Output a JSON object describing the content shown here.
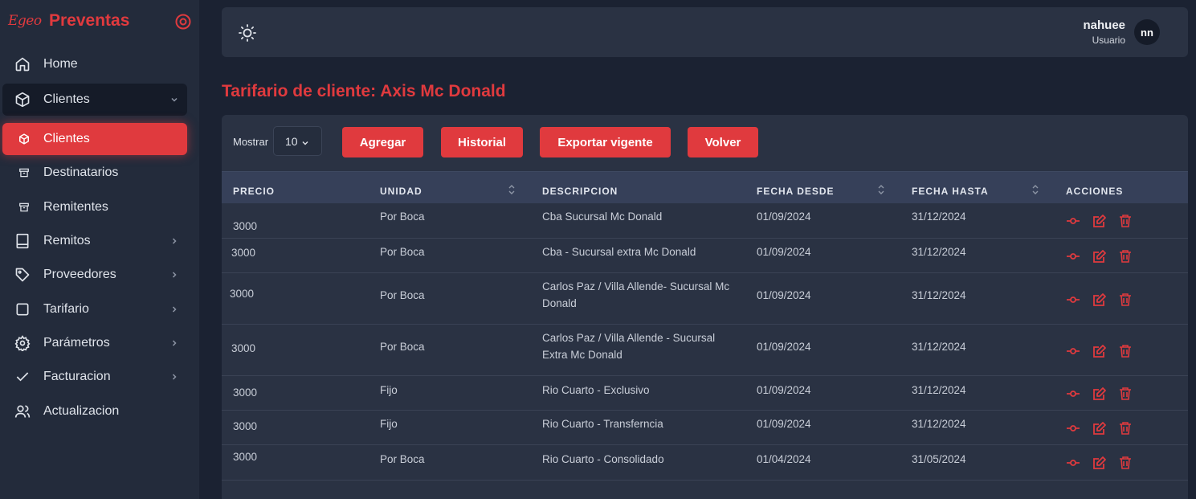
{
  "app": {
    "logo_text": "Egeo",
    "name": "Preventas"
  },
  "sidebar": {
    "items": [
      {
        "label": "Home",
        "icon": "home-icon"
      },
      {
        "label": "Clientes",
        "icon": "cube-icon"
      },
      {
        "label": "Clientes",
        "icon": "cube-icon"
      },
      {
        "label": "Destinatarios",
        "icon": "archive-icon"
      },
      {
        "label": "Remitentes",
        "icon": "archive-icon"
      },
      {
        "label": "Remitos",
        "icon": "book-icon"
      },
      {
        "label": "Proveedores",
        "icon": "tag-icon"
      },
      {
        "label": "Tarifario",
        "icon": "square-icon"
      },
      {
        "label": "Parámetros",
        "icon": "gear-icon"
      },
      {
        "label": "Facturacion",
        "icon": "check-icon"
      },
      {
        "label": "Actualizacion",
        "icon": "users-icon"
      }
    ]
  },
  "header": {
    "user_name": "nahuee",
    "user_role": "Usuario",
    "avatar_initials": "nn"
  },
  "page": {
    "title": "Tarifario de cliente: Axis Mc Donald"
  },
  "toolbar": {
    "show_label": "Mostrar",
    "show_value": "10",
    "add_label": "Agregar",
    "history_label": "Historial",
    "export_label": "Exportar vigente",
    "back_label": "Volver"
  },
  "table": {
    "headers": [
      "PRECIO",
      "UNIDAD",
      "DESCRIPCION",
      "FECHA DESDE",
      "FECHA HASTA",
      "ACCIONES"
    ],
    "rows": [
      {
        "precio": "3000",
        "unidad": "Por Boca",
        "descripcion": "Cba Sucursal Mc Donald",
        "desde": "01/09/2024",
        "hasta": "31/12/2024"
      },
      {
        "precio": "3000",
        "unidad": "Por Boca",
        "descripcion": "Cba - Sucursal extra Mc Donald",
        "desde": "01/09/2024",
        "hasta": "31/12/2024"
      },
      {
        "precio": "3000",
        "unidad": "Por Boca",
        "descripcion": "Carlos Paz / Villa Allende- Sucursal Mc Donald",
        "desde": "01/09/2024",
        "hasta": "31/12/2024"
      },
      {
        "precio": "3000",
        "unidad": "Por Boca",
        "descripcion": "Carlos Paz / Villa Allende - Sucursal Extra Mc Donald",
        "desde": "01/09/2024",
        "hasta": "31/12/2024"
      },
      {
        "precio": "3000",
        "unidad": "Fijo",
        "descripcion": "Rio Cuarto - Exclusivo",
        "desde": "01/09/2024",
        "hasta": "31/12/2024"
      },
      {
        "precio": "3000",
        "unidad": "Fijo",
        "descripcion": "Rio Cuarto - Transferncia",
        "desde": "01/09/2024",
        "hasta": "31/12/2024"
      },
      {
        "precio": "3000",
        "unidad": "Por Boca",
        "descripcion": "Rio Cuarto - Consolidado",
        "desde": "01/04/2024",
        "hasta": "31/05/2024"
      }
    ]
  },
  "colors": {
    "accent": "#e03a3e",
    "sidebar_bg": "#232b3b",
    "page_bg": "#1b2232",
    "card_bg": "#2a3243",
    "table_header_bg": "#364059"
  }
}
